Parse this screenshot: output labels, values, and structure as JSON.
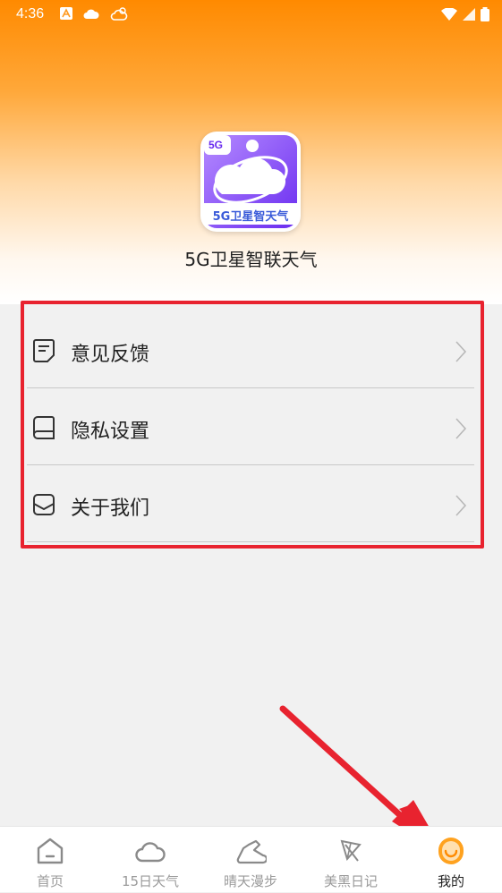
{
  "status_bar": {
    "time": "4:36"
  },
  "app": {
    "name": "5G卫星智联天气",
    "logo_badge": "5G",
    "logo_text": "5G卫星智天气"
  },
  "menu": {
    "items": [
      {
        "label": "意见反馈",
        "icon": "feedback-doc-icon"
      },
      {
        "label": "隐私设置",
        "icon": "book-icon"
      },
      {
        "label": "关于我们",
        "icon": "inbox-icon"
      }
    ]
  },
  "tabs": [
    {
      "label": "首页",
      "icon": "home-icon",
      "active": false
    },
    {
      "label": "15日天气",
      "icon": "cloud-icon",
      "active": false
    },
    {
      "label": "晴天漫步",
      "icon": "shoe-icon",
      "active": false
    },
    {
      "label": "美黑日记",
      "icon": "umbrella-icon",
      "active": false
    },
    {
      "label": "我的",
      "icon": "smile-icon",
      "active": true
    }
  ],
  "colors": {
    "accent": "#ff8a00",
    "highlight": "#e8232f",
    "active_tab_icon": "#ffa21f"
  }
}
